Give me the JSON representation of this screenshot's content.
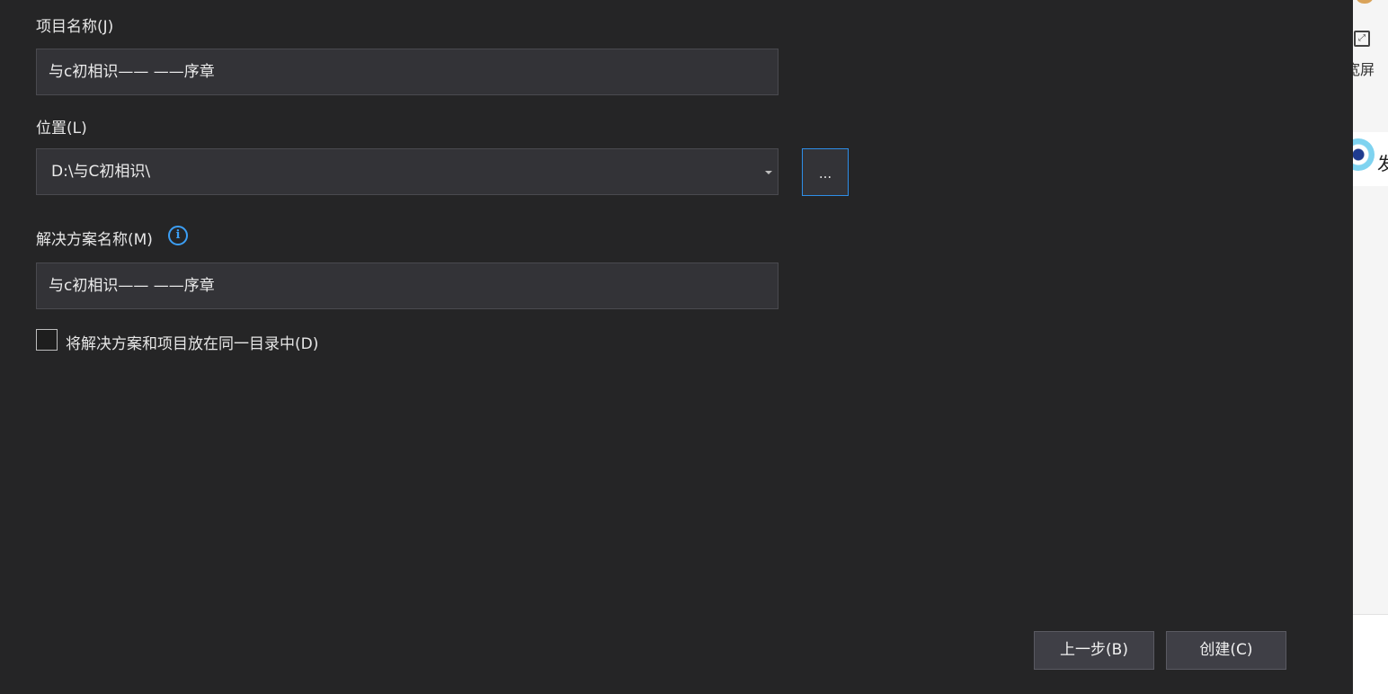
{
  "dialog": {
    "project_name": {
      "label": "项目名称(J)",
      "value": "与c初相识—— ——序章"
    },
    "location": {
      "label": "位置(L)",
      "value": "D:\\与C初相识\\",
      "browse_label": "..."
    },
    "solution_name": {
      "label": "解决方案名称(M)",
      "info_icon": "i",
      "value": "与c初相识—— ——序章"
    },
    "same_dir_checkbox": {
      "label": "将解决方案和项目放在同一目录中(D)",
      "checked": false
    },
    "buttons": {
      "back": "上一步(B)",
      "create": "创建(C)"
    }
  },
  "right_panel": {
    "fullscreen_label": "宽屏",
    "card_text": "发"
  },
  "colors": {
    "background": "#252526",
    "field_background": "#333337",
    "accent_blue": "#2e8ee8"
  }
}
